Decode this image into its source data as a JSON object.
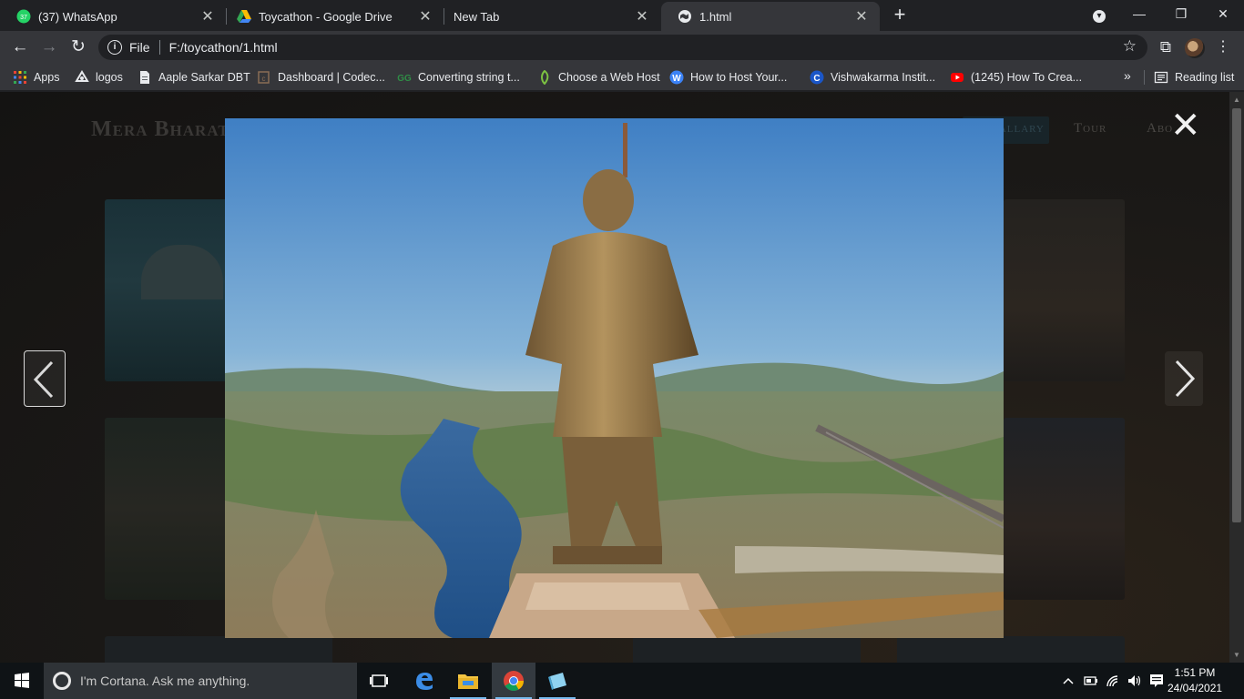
{
  "browser": {
    "tabs": [
      {
        "title": "(37) WhatsApp",
        "badge": "37",
        "close": "✕"
      },
      {
        "title": "Toycathon - Google Drive",
        "close": "✕"
      },
      {
        "title": "New Tab",
        "close": "✕"
      },
      {
        "title": "1.html",
        "close": "✕",
        "active": true
      }
    ],
    "new_tab": "+",
    "window": {
      "menu": "▾",
      "minimize": "—",
      "restore": "❐",
      "close": "✕"
    },
    "nav": {
      "back": "←",
      "forward": "→",
      "reload": "↻"
    },
    "omnibox": {
      "info": "i",
      "scheme": "File",
      "url": "F:/toycathon/1.html",
      "star": "☆"
    },
    "extensions": "⧉",
    "menu": "⋮",
    "bookmarks": [
      {
        "label": "Apps",
        "icon": "apps-grid-icon"
      },
      {
        "label": "logos",
        "icon": "logos-icon"
      },
      {
        "label": "Aaple Sarkar DBT",
        "icon": "page-icon"
      },
      {
        "label": "Dashboard | Codec...",
        "icon": "codechef-icon"
      },
      {
        "label": "Converting string t...",
        "icon": "gfg-icon"
      },
      {
        "label": "Choose a Web Host",
        "icon": "webhost-icon"
      },
      {
        "label": "How to Host Your...",
        "icon": "wordpress-icon"
      },
      {
        "label": "Vishwakarma Instit...",
        "icon": "vit-icon"
      },
      {
        "label": "(1245) How To Crea...",
        "icon": "youtube-icon"
      }
    ],
    "bookmarks_more": "»",
    "reading_list": "Reading list"
  },
  "page": {
    "site_title": "Mera Bharat",
    "nav": [
      "Gallary",
      "Tour",
      "Abo"
    ],
    "lightbox": {
      "close": "✕",
      "prev": "‹",
      "next": "›"
    }
  },
  "taskbar": {
    "cortana_placeholder": "I'm Cortana. Ask me anything.",
    "time": "1:51 PM",
    "date": "24/04/2021"
  },
  "colors": {
    "tab_active": "#35363a",
    "frame": "#202124",
    "taskbar": "#0f1316",
    "highlight": "#76b9ed"
  }
}
